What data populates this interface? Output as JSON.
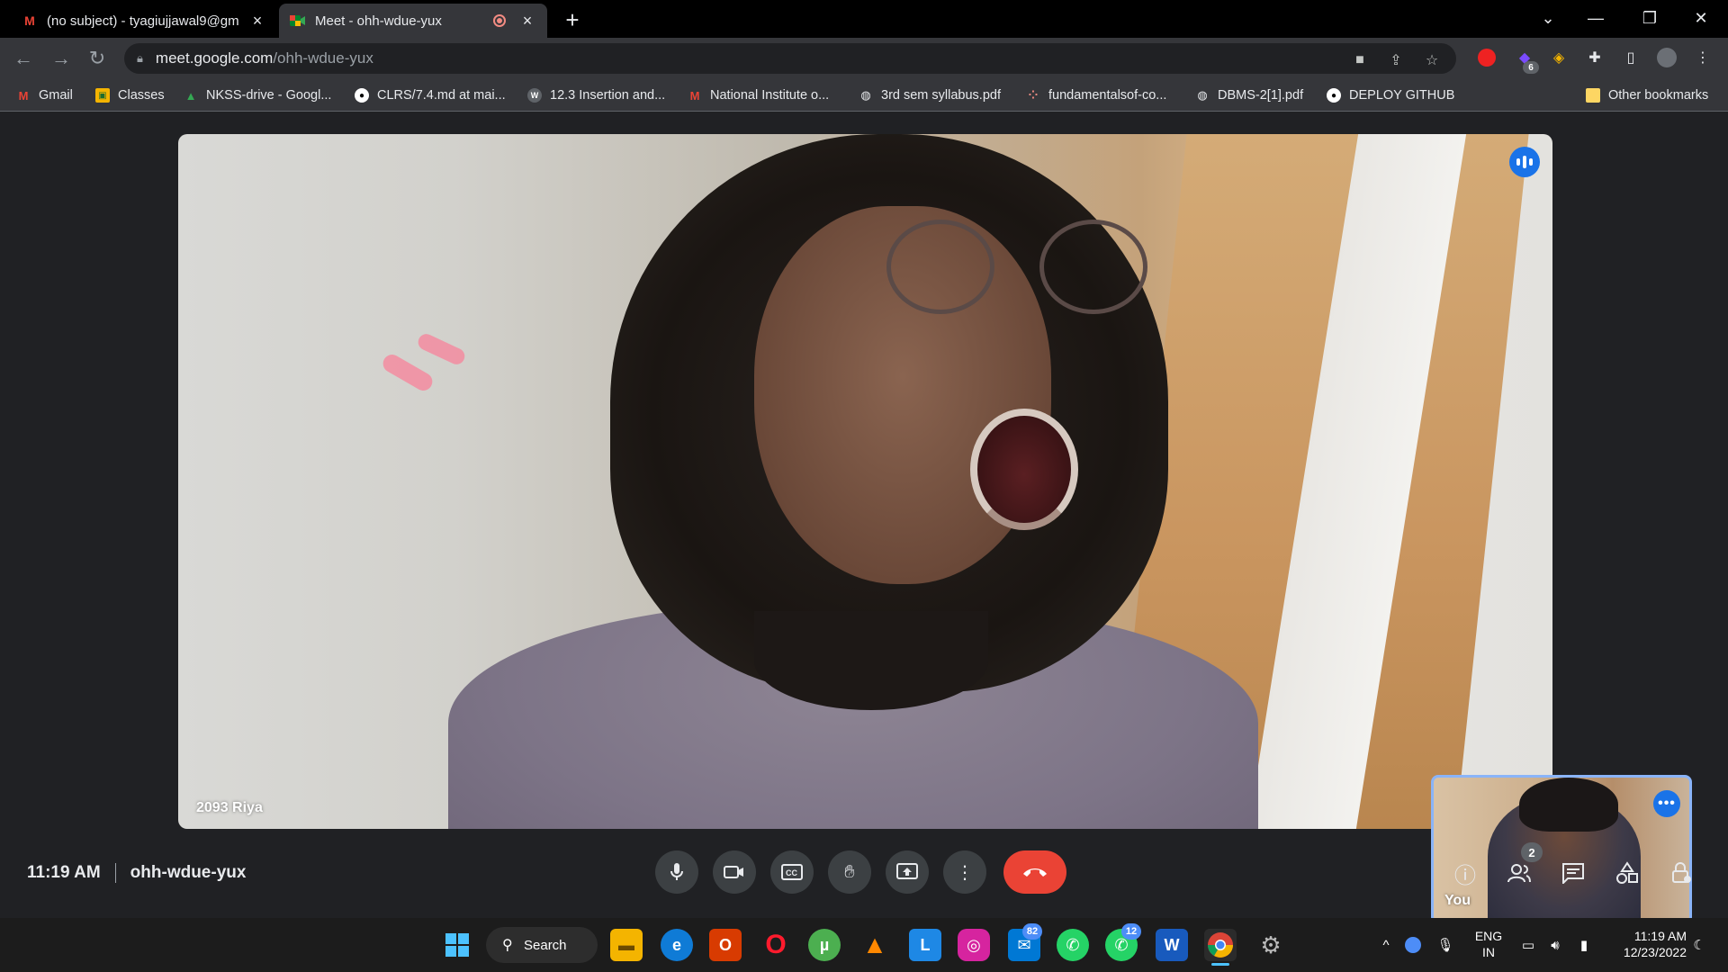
{
  "browser": {
    "tabs": [
      {
        "title": "(no subject) - tyagiujjawal9@gm",
        "favicon": "gmail-icon",
        "close": "×"
      },
      {
        "title": "Meet - ohh-wdue-yux",
        "favicon": "meet-icon",
        "close": "×"
      }
    ],
    "new_tab": "+",
    "window_controls": {
      "dropdown": "⌄",
      "minimize": "—",
      "restore": "❐",
      "close": "✕"
    },
    "url_host": "meet.google.com",
    "url_path": "/ohh-wdue-yux",
    "extension_badge": "6"
  },
  "bookmarks": [
    {
      "label": "Gmail",
      "icon": "gmail-icon"
    },
    {
      "label": "Classes",
      "icon": "classroom-icon"
    },
    {
      "label": "NKSS-drive - Googl...",
      "icon": "drive-icon"
    },
    {
      "label": "CLRS/7.4.md at mai...",
      "icon": "github-icon"
    },
    {
      "label": "12.3 Insertion and...",
      "icon": "web-icon"
    },
    {
      "label": "National Institute o...",
      "icon": "gmail-icon"
    },
    {
      "label": "3rd sem syllabus.pdf",
      "icon": "globe-icon"
    },
    {
      "label": "fundamentalsof-co...",
      "icon": "dots-icon"
    },
    {
      "label": "DBMS-2[1].pdf",
      "icon": "globe-icon"
    },
    {
      "label": "DEPLOY GITHUB",
      "icon": "github-icon"
    }
  ],
  "other_bookmarks": "Other bookmarks",
  "meet": {
    "main_participant": "2093 Riya",
    "self_label": "You",
    "clock": "11:19 AM",
    "meeting_code": "ohh-wdue-yux",
    "people_count": "2"
  },
  "taskbar": {
    "search_label": "Search",
    "mail_badge": "82",
    "whatsapp_badge": "12",
    "language_line1": "ENG",
    "language_line2": "IN",
    "time": "11:19 AM",
    "date": "12/23/2022"
  },
  "colors": {
    "accent": "#1a73e8",
    "end_call": "#ea4335",
    "self_border": "#8ab4f8"
  }
}
